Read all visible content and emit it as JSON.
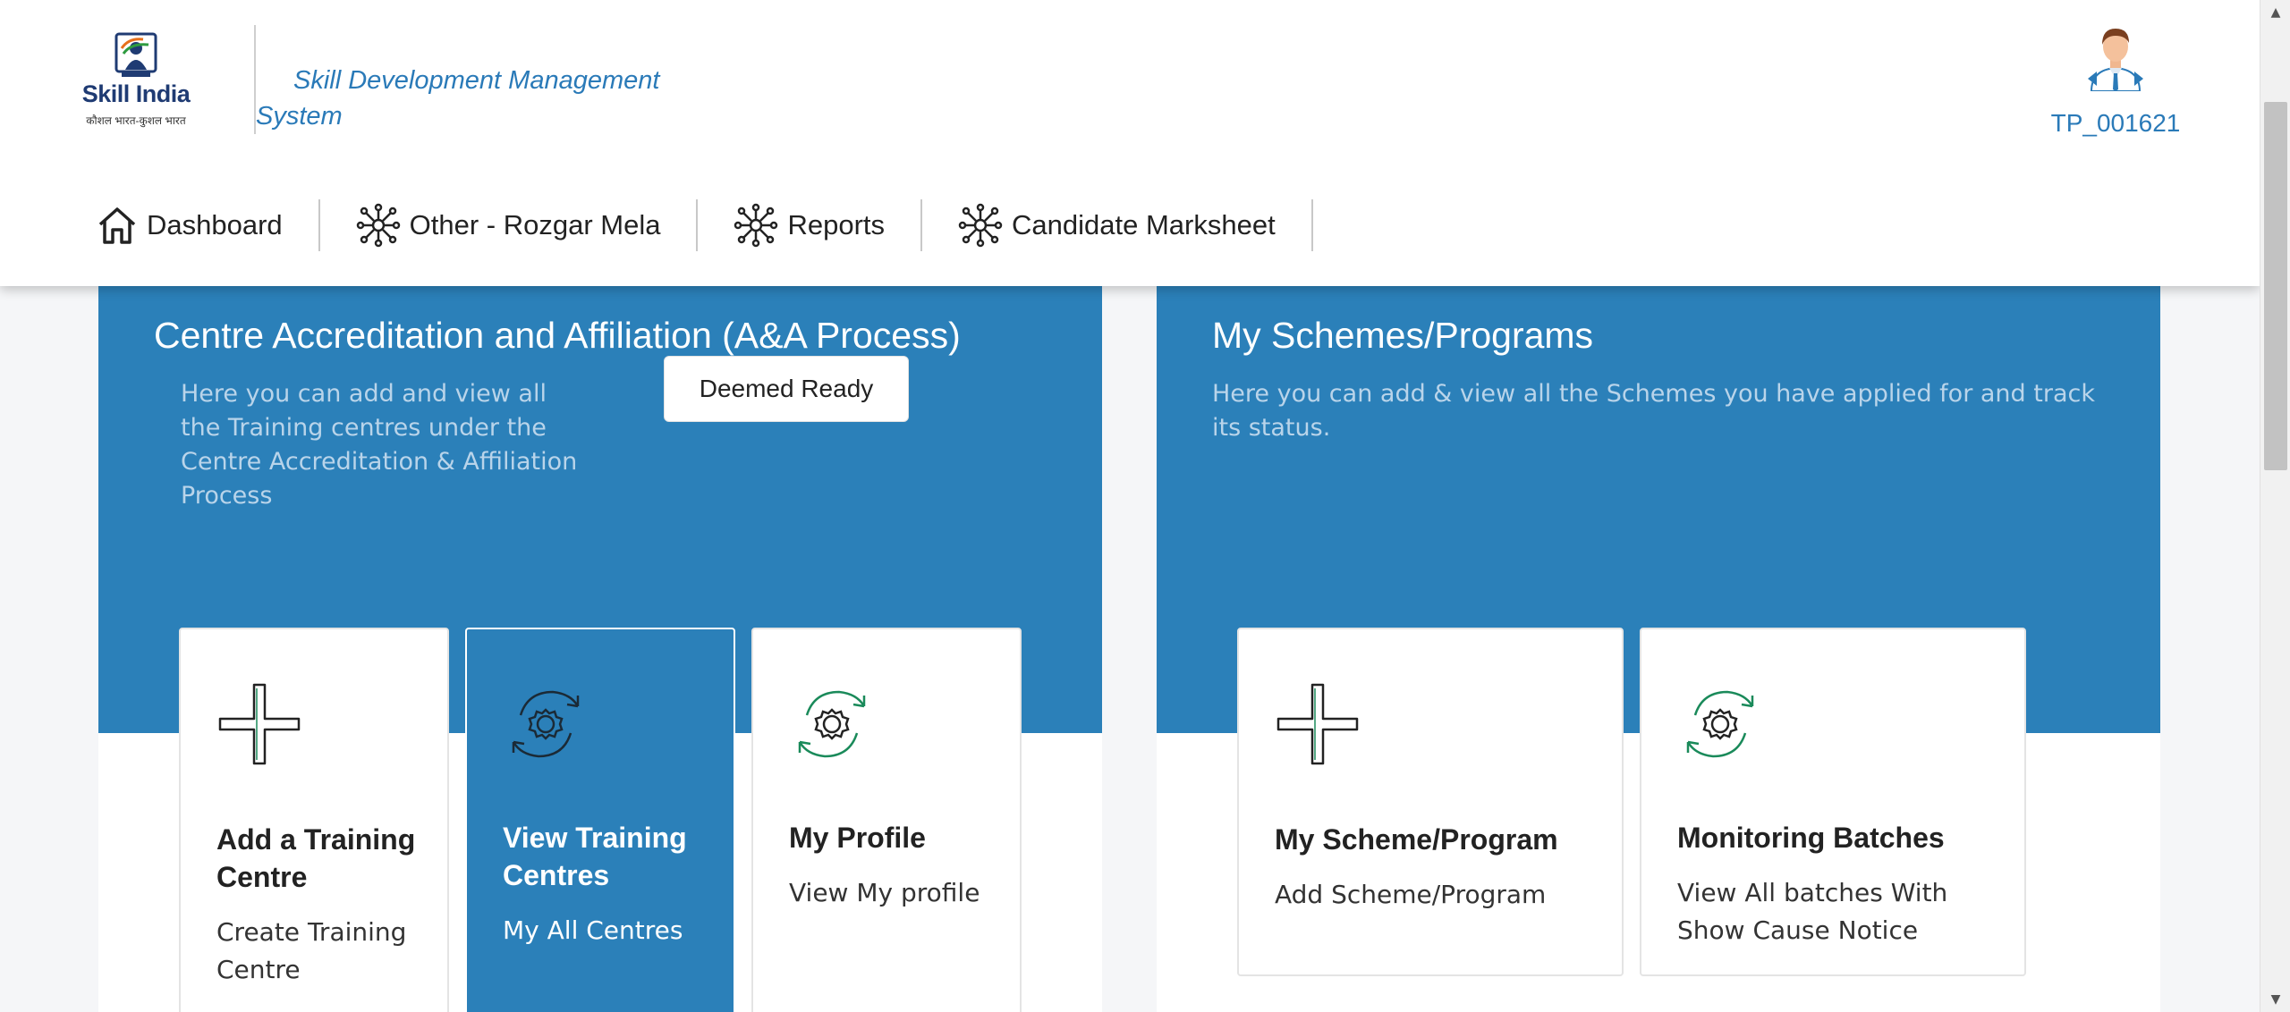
{
  "header": {
    "logo": {
      "word": "Skill India",
      "tagline": "कौशल भारत-कुशल भारत"
    },
    "app_title": "Skill Development Management System",
    "user_id": "TP_001621"
  },
  "nav": {
    "items": [
      {
        "label": "Dashboard",
        "icon": "home-icon"
      },
      {
        "label": "Other - Rozgar Mela",
        "icon": "network-icon"
      },
      {
        "label": "Reports",
        "icon": "network-icon"
      },
      {
        "label": "Candidate Marksheet",
        "icon": "network-icon"
      }
    ]
  },
  "panels": {
    "left": {
      "title": "Centre Accreditation and Affiliation (A&A Process)",
      "description": "Here you can add and view all the Training centres under the Centre Accreditation & Affiliation Process",
      "button_label": "Deemed Ready",
      "cards": [
        {
          "title": "Add a Training Centre",
          "subtitle": "Create Training Centre",
          "icon": "plus-icon",
          "active": false
        },
        {
          "title": "View Training Centres",
          "subtitle": "My All Centres",
          "icon": "gear-refresh-icon",
          "active": true
        },
        {
          "title": "My Profile",
          "subtitle": "View My profile",
          "icon": "gear-refresh-icon",
          "active": false
        }
      ]
    },
    "right": {
      "title": "My Schemes/Programs",
      "description": "Here you can add & view all the Schemes you have applied for and track its status.",
      "cards": [
        {
          "title": "My Scheme/Program",
          "subtitle": "Add Scheme/Program",
          "icon": "plus-icon",
          "active": false
        },
        {
          "title": "Monitoring Batches",
          "subtitle": "View All batches With Show Cause Notice",
          "icon": "gear-refresh-icon",
          "active": false
        }
      ]
    }
  },
  "colors": {
    "primary_blue": "#2b80b9",
    "title_blue": "#2a7ab8",
    "desc_text": "#b9d4ea"
  }
}
